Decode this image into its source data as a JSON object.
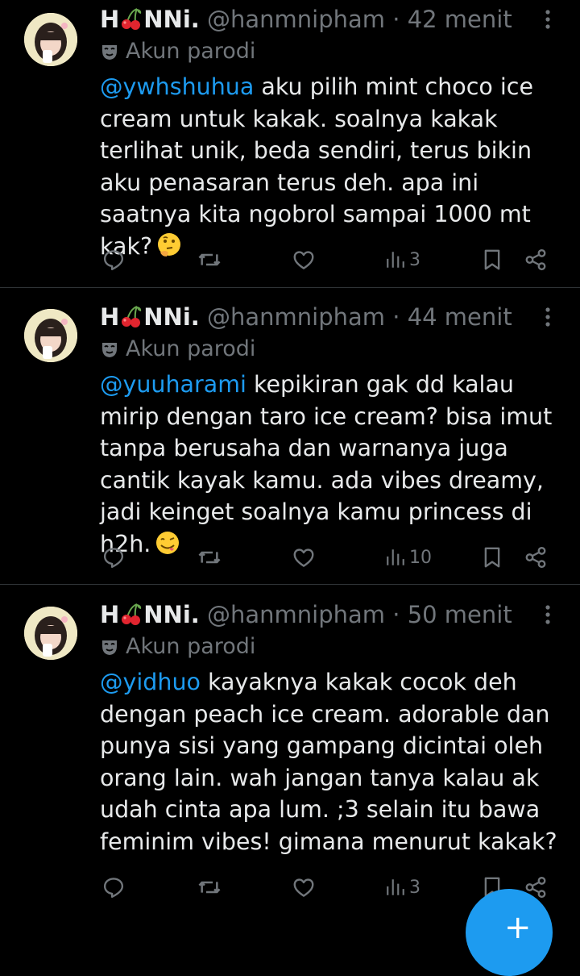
{
  "tweets": [
    {
      "display_name_prefix": "H",
      "display_name_suffix": "NNi.",
      "handle": "@hanmnipham",
      "separator": "·",
      "time": "42 menit",
      "parody_label": "Akun parodi",
      "mention": "@ywhshuhua",
      "text": " aku pilih mint choco ice cream untuk kakak. soalnya kakak terlihat unik, beda sendiri, terus bikin aku penasaran terus deh. apa ini saatnya kita ngobrol sampai 1000 mt kak?",
      "emoji": "thinking-face-emoji",
      "views": "3"
    },
    {
      "display_name_prefix": "H",
      "display_name_suffix": "NNi.",
      "handle": "@hanmnipham",
      "separator": "·",
      "time": "44 menit",
      "parody_label": "Akun parodi",
      "mention": "@yuuharami",
      "text": " kepikiran gak dd kalau mirip dengan taro ice cream? bisa imut tanpa berusaha dan warnanya juga cantik kayak kamu. ada vibes dreamy, jadi keinget soalnya kamu princess di h2h.",
      "emoji": "savoring-face-emoji",
      "views": "10"
    },
    {
      "display_name_prefix": "H",
      "display_name_suffix": "NNi.",
      "handle": "@hanmnipham",
      "separator": "·",
      "time": "50 menit",
      "parody_label": "Akun parodi",
      "mention": "@yidhuo",
      "text": " kayaknya kakak cocok deh dengan peach ice cream. adorable dan punya sisi yang gampang dicintai oleh orang lain. wah jangan tanya kalau ak udah cinta apa lum. ;3 selain itu bawa feminim vibes! gimana menurut kakak?",
      "emoji": "",
      "views": "3"
    }
  ],
  "icons": {
    "name_emoji": "cherries-emoji",
    "parody": "mask-icon",
    "reply": "reply-icon",
    "retweet": "retweet-icon",
    "like": "like-icon",
    "views": "views-icon",
    "bookmark": "bookmark-icon",
    "share": "share-icon",
    "more": "more-icon",
    "compose": "plus-icon"
  },
  "fab": {
    "label": "+"
  },
  "colors": {
    "background": "#000000",
    "text": "#e7e9ea",
    "muted": "#71767b",
    "accent": "#1d9bf0",
    "divider": "#2f3336"
  }
}
